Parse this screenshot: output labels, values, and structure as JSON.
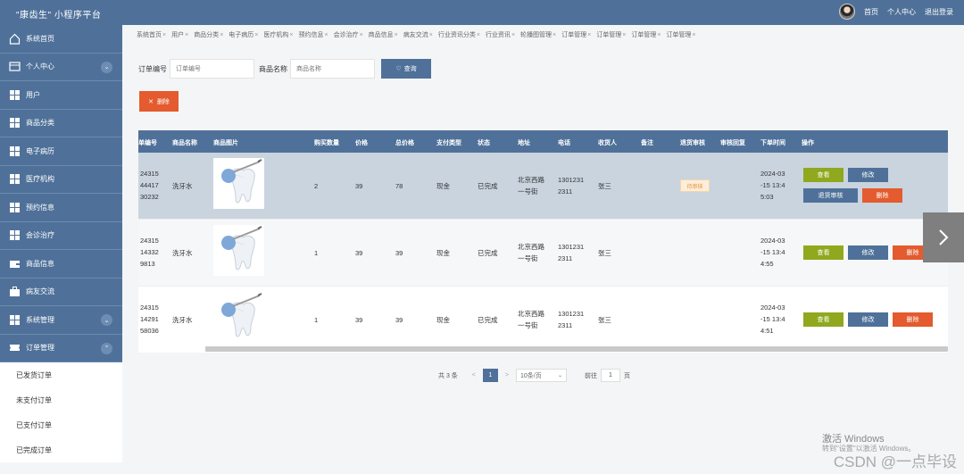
{
  "header": {
    "title": "\"康齿生\" 小程序平台",
    "home": "首页",
    "profile": "个人中心",
    "logout": "退出登录"
  },
  "sidebar": {
    "items": [
      {
        "label": "系统首页",
        "icon": "home-icon"
      },
      {
        "label": "个人中心",
        "icon": "window-icon",
        "chevron": "⌄"
      },
      {
        "label": "用户",
        "icon": "grid-icon"
      },
      {
        "label": "商品分类",
        "icon": "grid-icon"
      },
      {
        "label": "电子病历",
        "icon": "grid-icon"
      },
      {
        "label": "医疗机构",
        "icon": "grid-icon"
      },
      {
        "label": "预约信息",
        "icon": "grid-icon"
      },
      {
        "label": "会诊治疗",
        "icon": "grid-icon"
      },
      {
        "label": "商品信息",
        "icon": "wallet-icon"
      },
      {
        "label": "病友交流",
        "icon": "briefcase-icon"
      },
      {
        "label": "系统管理",
        "icon": "grid-icon",
        "chevron": "⌄"
      },
      {
        "label": "订单管理",
        "icon": "ticket-icon",
        "chevron": "⌃"
      }
    ],
    "subitems": [
      "已发货订单",
      "未支付订单",
      "已支付订单",
      "已完成订单"
    ]
  },
  "tabs": [
    "系统首页",
    "用户",
    "商品分类",
    "电子病历",
    "医疗机构",
    "预约信息",
    "会诊治疗",
    "商品信息",
    "病友交流",
    "行业资讯分类",
    "行业资讯",
    "轮播图管理",
    "订单管理",
    "订单管理",
    "订单管理",
    "订单管理"
  ],
  "search": {
    "order_label": "订单编号",
    "order_placeholder": "订单编号",
    "product_label": "商品名称",
    "product_placeholder": "商品名称",
    "query_button": "查询",
    "delete_button": "删除"
  },
  "table": {
    "headers": [
      "单编号",
      "商品名称",
      "商品图片",
      "购买数量",
      "价格",
      "总价格",
      "支付类型",
      "状态",
      "地址",
      "电话",
      "收货人",
      "备注",
      "退货审核",
      "审核回复",
      "下单时间",
      "操作"
    ],
    "rows": [
      {
        "id": [
          "24315",
          "44417",
          "30232"
        ],
        "name": "洗牙水",
        "qty": "2",
        "price": "39",
        "total": "78",
        "pay": "现金",
        "status": "已完成",
        "addr": [
          "北京西路",
          "一号街"
        ],
        "phone": [
          "1301231",
          "2311"
        ],
        "receiver": "张三",
        "audit": "待审核",
        "time": [
          "2024-03",
          "-15 13:4",
          "5:03"
        ],
        "ops": [
          "查看",
          "修改",
          "退货审核",
          "删除"
        ]
      },
      {
        "id": [
          "24315",
          "14332",
          "9813"
        ],
        "name": "洗牙水",
        "qty": "1",
        "price": "39",
        "total": "39",
        "pay": "现金",
        "status": "已完成",
        "addr": [
          "北京西路",
          "一号街"
        ],
        "phone": [
          "1301231",
          "2311"
        ],
        "receiver": "张三",
        "audit": "",
        "time": [
          "2024-03",
          "-15 13:4",
          "4:55"
        ],
        "ops": [
          "查看",
          "修改",
          "删除"
        ]
      },
      {
        "id": [
          "24315",
          "14291",
          "58036"
        ],
        "name": "洗牙水",
        "qty": "1",
        "price": "39",
        "total": "39",
        "pay": "现金",
        "status": "已完成",
        "addr": [
          "北京西路",
          "一号街"
        ],
        "phone": [
          "1301231",
          "2311"
        ],
        "receiver": "张三",
        "audit": "",
        "time": [
          "2024-03",
          "-15 13:4",
          "4:51"
        ],
        "ops": [
          "查看",
          "修改",
          "删除"
        ]
      }
    ]
  },
  "pager": {
    "total": "共 3 条",
    "prev": "<",
    "page": "1",
    "next": ">",
    "size": "10条/页",
    "goto": "前往",
    "goto_value": "1",
    "page_unit": "页"
  },
  "overlay": {
    "win_line1": "激活 Windows",
    "win_line2": "转到\"设置\"以激活 Windows。",
    "csdn": "CSDN @一点毕设"
  },
  "colors": {
    "primary": "#4f7199",
    "danger": "#e35b2e",
    "success": "#8fa81e",
    "warning": "#e89232"
  }
}
